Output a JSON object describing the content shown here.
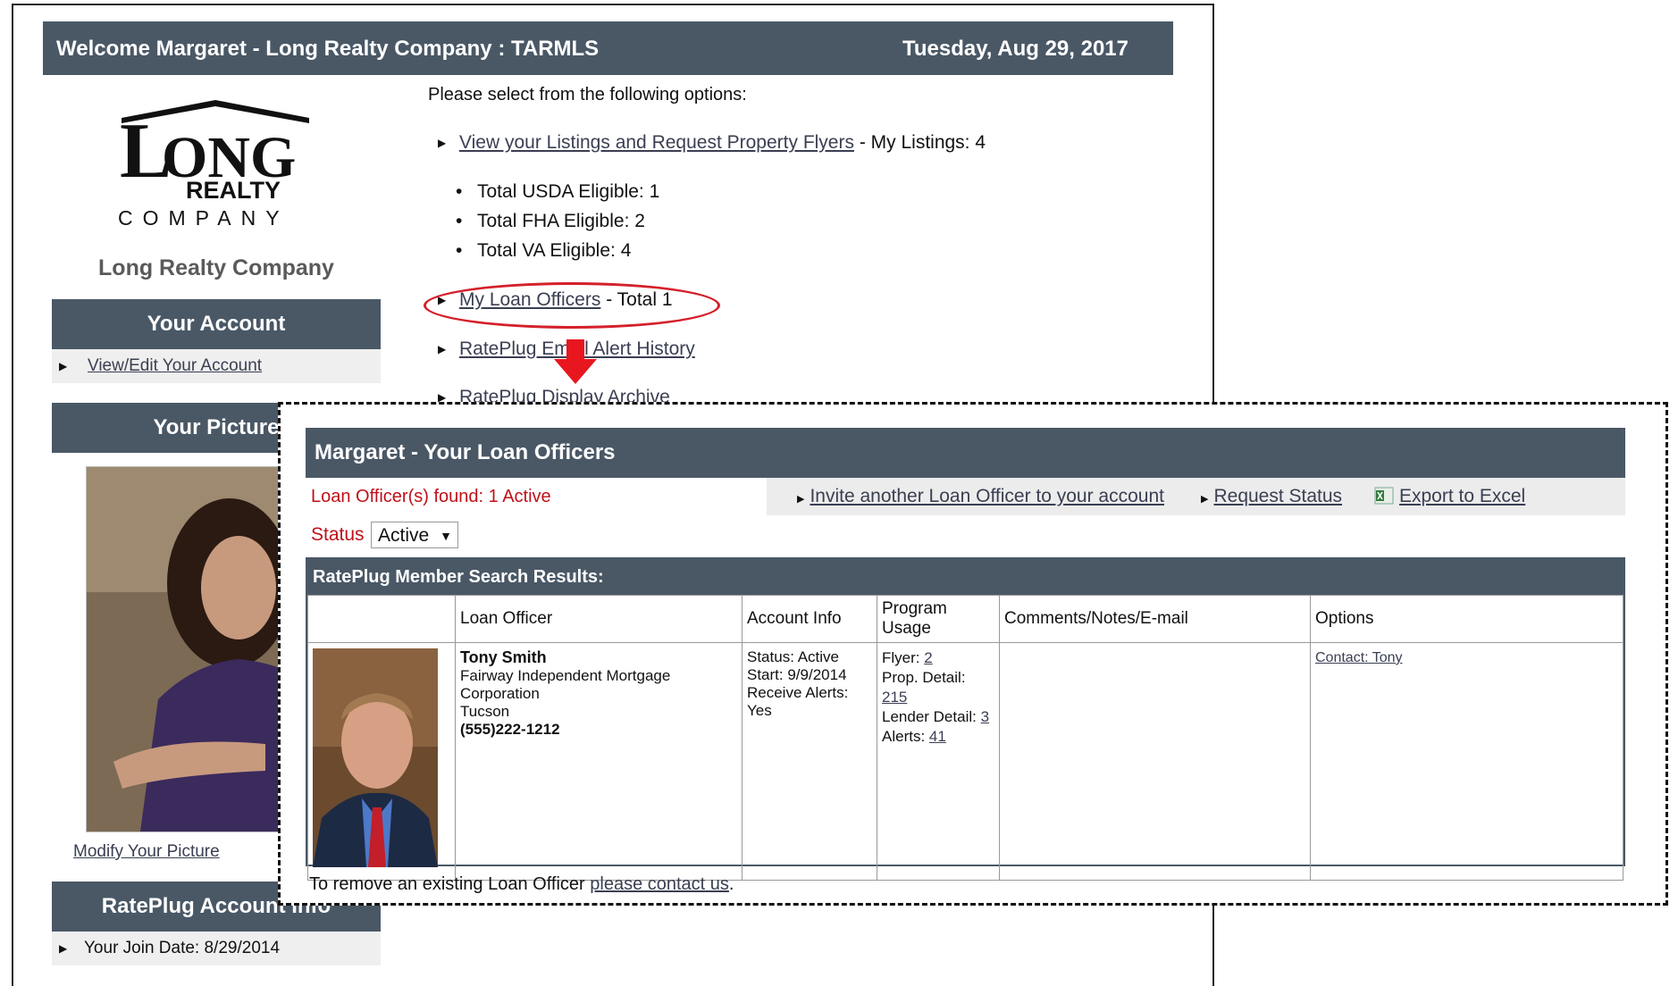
{
  "header": {
    "welcome": "Welcome Margaret - Long Realty Company : TARMLS",
    "date": "Tuesday, Aug 29, 2017"
  },
  "logo": {
    "top": "ONG",
    "realty": "REALTY",
    "company": "COMPANY"
  },
  "company_name": "Long Realty Company",
  "sidebar": {
    "account_title": "Your Account",
    "account_link": "View/Edit Your Account",
    "picture_title": "Your Picture",
    "modify_picture": "Modify Your Picture",
    "info_title": "RatePlug Account Info",
    "join_date": "Your Join Date: 8/29/2014"
  },
  "main": {
    "intro": "Please select from the following options:",
    "listings_link": "View your Listings and Request Property Flyers",
    "listings_suffix": "- My Listings: 4",
    "eligibility": [
      "Total USDA Eligible: 1",
      "Total FHA Eligible: 2",
      "Total VA Eligible: 4"
    ],
    "loan_officers_link": "My Loan Officers",
    "loan_officers_suffix": "- Total 1",
    "email_alert_link": "RatePlug Email Alert History",
    "display_archive_link": "RatePlug Display Archive"
  },
  "popup": {
    "title": "Margaret - Your Loan Officers",
    "found": "Loan Officer(s) found: 1 Active",
    "invite_link": "Invite another Loan Officer to your account",
    "request_status_link": "Request Status",
    "export_link": "Export to Excel",
    "status_label": "Status",
    "status_value": "Active",
    "results_title": "RatePlug Member Search Results:",
    "columns": [
      "",
      "Loan Officer",
      "Account Info",
      "Program Usage",
      "Comments/Notes/E-mail",
      "Options"
    ],
    "row": {
      "name": "Tony Smith",
      "company": "Fairway Independent Mortgage Corporation",
      "city": "Tucson",
      "phone": "(555)222-1212",
      "status": "Status: Active",
      "start": "Start: 9/9/2014",
      "alerts_pref": "Receive Alerts: Yes",
      "flyer_label": "Flyer:",
      "flyer_value": "2",
      "prop_label": "Prop. Detail:",
      "prop_value": "215",
      "lender_label": "Lender Detail:",
      "lender_value": "3",
      "alerts_label": "Alerts:",
      "alerts_value": "41",
      "comments": "",
      "contact_link": "Contact: Tony"
    },
    "remove_note": "To remove an existing Loan Officer",
    "remove_link": "please contact us",
    "remove_end": "."
  },
  "colors": {
    "header_bg": "#4a5866",
    "highlight": "#d4202a",
    "alert_text": "#c0101a"
  }
}
